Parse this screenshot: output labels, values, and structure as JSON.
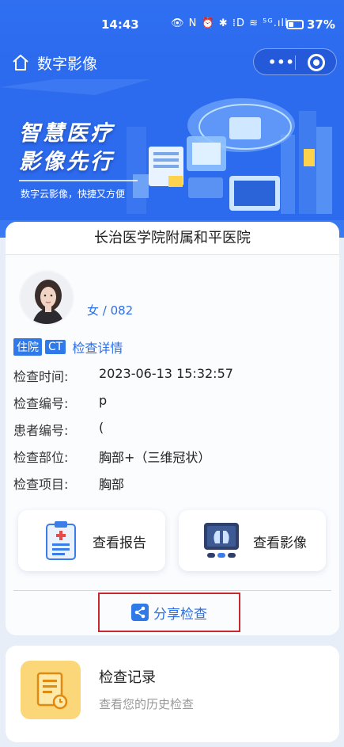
{
  "status_bar": {
    "time": "14:43",
    "icons": "👁 N ⏰ ✱ ⁞D ≋ ⁵ᴳ.ıll",
    "battery_percent": "37%",
    "battery_level": 0.37
  },
  "nav": {
    "title": "数字影像",
    "more_label": "•••"
  },
  "banner": {
    "line1": "智慧医疗",
    "line2": "影像先行",
    "subtitle": "数字云影像，快捷又方便"
  },
  "card": {
    "hospital_name": "长治医学院附属和平医院",
    "patient": {
      "name": "",
      "gender_age": "女 / 082"
    },
    "badges": [
      "住院",
      "CT"
    ],
    "detail_link": "检查详情",
    "info_rows": [
      {
        "label": "检查时间:",
        "value": "2023-06-13 15:32:57"
      },
      {
        "label": "检查编号:",
        "value": "p"
      },
      {
        "label": "患者编号:",
        "value": "("
      },
      {
        "label": "检查部位:",
        "value": "胸部+（三维冠状）"
      },
      {
        "label": "检查项目:",
        "value": "胸部"
      }
    ],
    "view_report_label": "查看报告",
    "view_image_label": "查看影像",
    "share_label": "分享检查"
  },
  "records": {
    "title": "检查记录",
    "subtitle": "查看您的历史检查"
  },
  "colors": {
    "primary": "#2f6ff0",
    "accent_link": "#2a6fe8",
    "share_border": "#c8292f"
  }
}
